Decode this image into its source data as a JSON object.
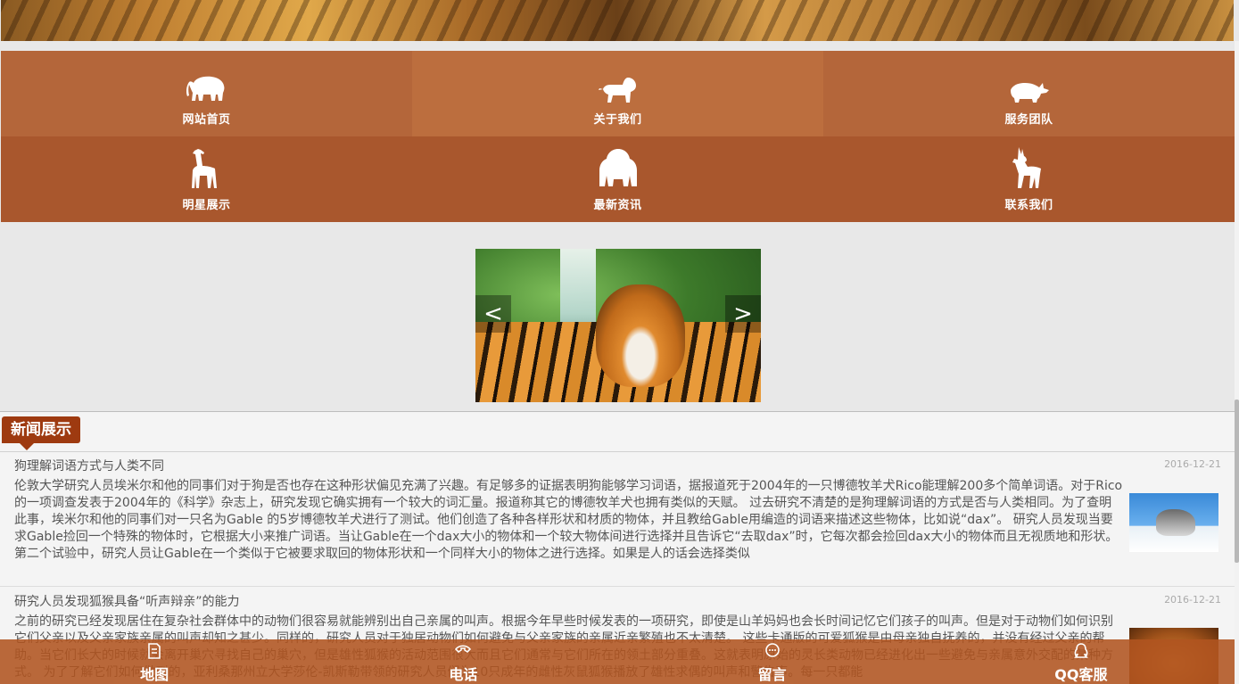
{
  "nav": {
    "items": [
      {
        "label": "网站首页",
        "icon": "elephant-icon"
      },
      {
        "label": "关于我们",
        "icon": "lion-icon"
      },
      {
        "label": "服务团队",
        "icon": "rhino-icon"
      },
      {
        "label": "明星展示",
        "icon": "giraffe-icon"
      },
      {
        "label": "最新资讯",
        "icon": "baboon-icon"
      },
      {
        "label": "联系我们",
        "icon": "antelope-icon"
      }
    ]
  },
  "slider": {
    "prev_label": "<",
    "next_label": ">"
  },
  "news": {
    "section_title": "新闻展示",
    "items": [
      {
        "title": "狗理解词语方式与人类不同",
        "date": "2016-12-21",
        "text": "伦敦大学研究人员埃米尔和他的同事们对于狗是否也存在这种形状偏见充满了兴趣。有足够多的证据表明狗能够学习词语，据报道死于2004年的一只博德牧羊犬Rico能理解200多个简单词语。对于Rico的一项调查发表于2004年的《科学》杂志上，研究发现它确实拥有一个较大的词汇量。报道称其它的博德牧羊犬也拥有类似的天赋。 过去研究不清楚的是狗理解词语的方式是否与人类相同。为了查明此事，埃米尔和他的同事们对一只名为Gable 的5岁博德牧羊犬进行了测试。他们创造了各种各样形状和材质的物体，并且教给Gable用编造的词语来描述这些物体，比如说“dax”。 研究人员发现当要求Gable捡回一个特殊的物体时，它根据大小来推广词语。当让Gable在一个dax大小的物体和一个较大物体间进行选择并且告诉它“去取dax”时，它每次都会捡回dax大小的物体而且无视质地和形状。第二个试验中，研究人员让Gable在一个类似于它被要求取回的物体形状和一个同样大小的物体之进行选择。如果是人的话会选择类似"
      },
      {
        "title": "研究人员发现狐猴具备“听声辩亲”的能力",
        "date": "2016-12-21",
        "text": "之前的研究已经发现居住在复杂社会群体中的动物们很容易就能辨别出自己亲属的叫声。根据今年早些时候发表的一项研究，即使是山羊妈妈也会长时间记忆它们孩子的叫声。但是对于动物们如何识别它们父亲以及父亲家族亲属的叫声却知之甚少。同样的，研究人员对于独居动物们如何避免与父亲家族的亲属近亲繁殖也不太清楚。 这些卡通版的可爱狐猴是由母亲独自抚养的，并没有经过父亲的帮助。当它们长大的时候就会离开巢穴寻找自己的巢穴，但是雄性狐猴的活动范围很大而且它们通常与它们所在的领土部分重叠。这就表明原始的灵长类动物已经进化出一些避免与亲属意外交配的某种方式。 为了了解它们如何做到的，亚利桑那州立大学莎伦-凯斯勒带领的研究人员们为10只成年的雌性灰鼠狐猴播放了雄性求偶的叫声和警告声。每一只都能"
      }
    ]
  },
  "bottom_bar": {
    "items": [
      {
        "label": "地图",
        "icon": "map-icon"
      },
      {
        "label": "电话",
        "icon": "phone-icon"
      },
      {
        "label": "留言",
        "icon": "message-icon"
      },
      {
        "label": "QQ客服",
        "icon": "qq-icon"
      }
    ]
  }
}
